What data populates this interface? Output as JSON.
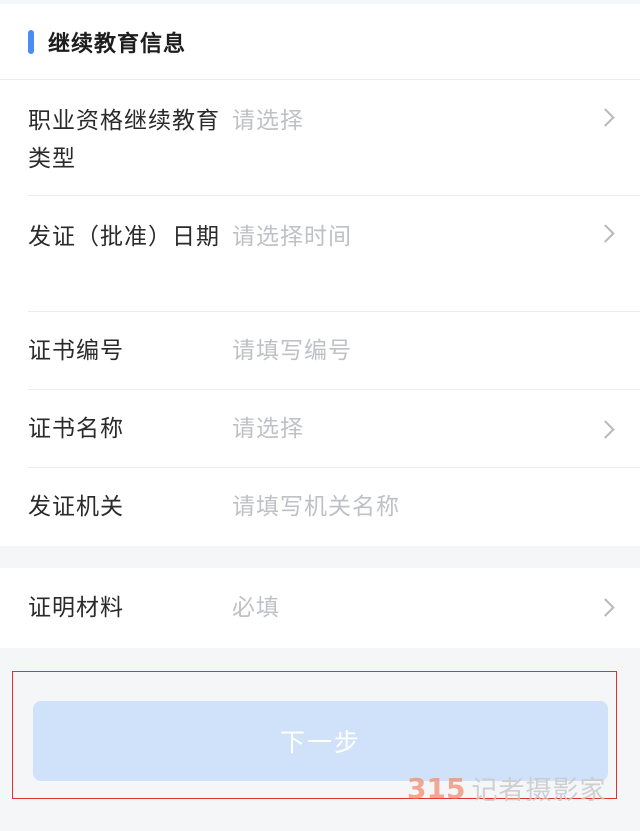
{
  "section": {
    "title": "继续教育信息"
  },
  "form": {
    "rows": [
      {
        "label": "职业资格继续教育类型",
        "value": "请选择"
      },
      {
        "label": "发证（批准）日期",
        "value": "请选择时间"
      },
      {
        "label": "证书编号",
        "value": "请填写编号"
      },
      {
        "label": "证书名称",
        "value": "请选择"
      },
      {
        "label": "发证机关",
        "value": "请填写机关名称"
      }
    ],
    "materials": {
      "label": "证明材料",
      "value": "必填"
    }
  },
  "actions": {
    "next_label": "下一步"
  },
  "watermark": {
    "logo": "315",
    "text": "记者摄影家"
  },
  "colors": {
    "accent": "#4a8cf6",
    "button_disabled": "#cfe2fa",
    "highlight_border": "#e0322f"
  },
  "icons": {
    "chevron": "chevron-right-icon"
  }
}
